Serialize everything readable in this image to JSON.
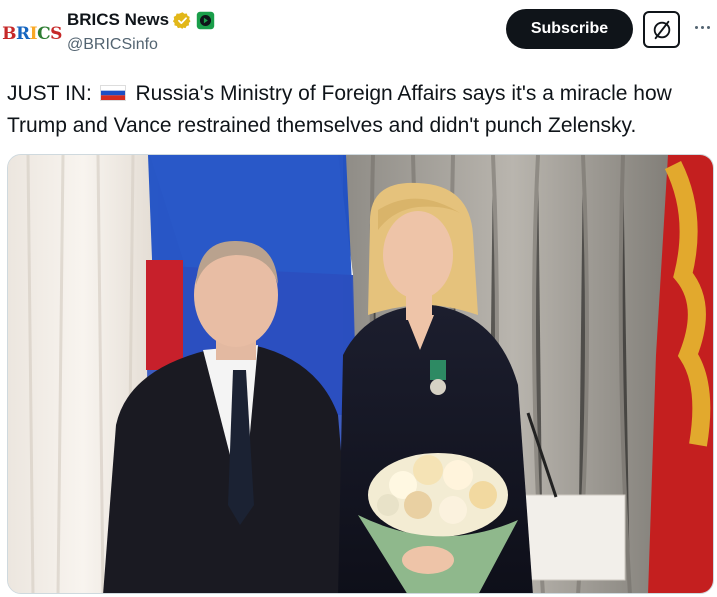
{
  "post": {
    "author": {
      "display_name": "BRICS News",
      "handle": "@BRICSinfo",
      "avatar_text": "BRICS",
      "verified_icon": "gold-verified-badge-icon",
      "affiliation_icon": "green-affiliate-badge-icon"
    },
    "actions": {
      "subscribe_label": "Subscribe",
      "grok_icon": "grok-slash-icon",
      "more_icon": "more-dots-icon"
    },
    "text": {
      "prefix": "JUST IN:",
      "flag_icon": "russia-flag-icon",
      "body": "Russia's Ministry of Foreign Affairs says it's a miracle how Trump and Vance restrained themselves and didn't punch Zelensky."
    },
    "media": {
      "type": "photo",
      "icon": "photo-of-two-people-at-award-ceremony"
    }
  },
  "colors": {
    "text_primary": "#0f1419",
    "text_secondary": "#536471",
    "verified_gold": "#e2b719",
    "affiliate_green": "#1a9e4a",
    "subscribe_bg": "#0f1419"
  }
}
